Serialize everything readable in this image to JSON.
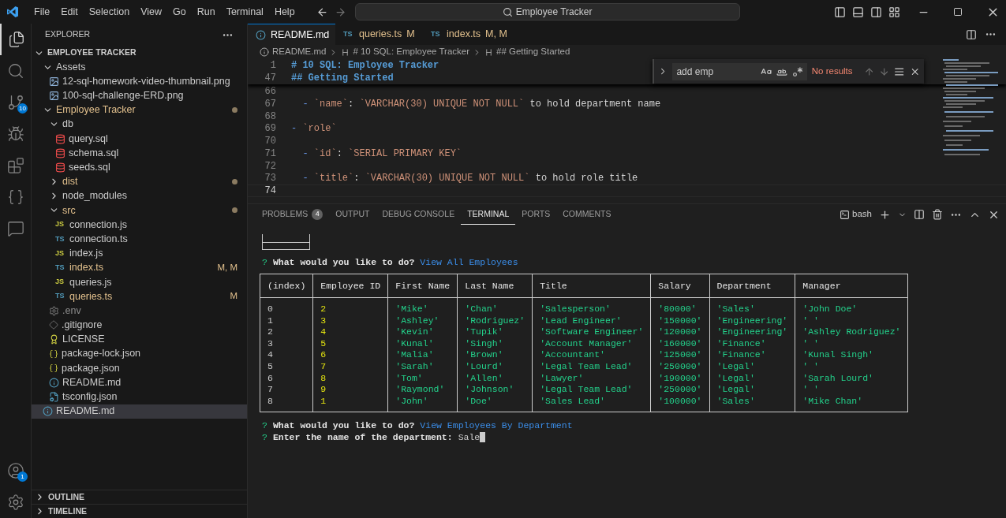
{
  "menu": [
    "File",
    "Edit",
    "Selection",
    "View",
    "Go",
    "Run",
    "Terminal",
    "Help"
  ],
  "command_center": "Employee Tracker",
  "activity_bar": [
    {
      "kind": "explorer",
      "selected": true
    },
    {
      "kind": "search",
      "selected": false
    },
    {
      "kind": "source-control",
      "selected": false,
      "badge": "10"
    },
    {
      "kind": "run",
      "selected": false
    },
    {
      "kind": "extensions",
      "selected": false
    },
    {
      "kind": "braces",
      "selected": false
    },
    {
      "kind": "chat",
      "selected": false
    }
  ],
  "activity_bottom": [
    {
      "kind": "account",
      "badge": "1"
    },
    {
      "kind": "settings"
    }
  ],
  "explorer": {
    "title": "EXPLORER",
    "root": {
      "name": "EMPLOYEE TRACKER",
      "expanded": true,
      "children": [
        {
          "name": "Assets",
          "kind": "folder",
          "expanded": true,
          "modified": false,
          "ignored": false,
          "dot": false,
          "selected": false,
          "children": [
            {
              "name": "12-sql-homework-video-thumbnail.png",
              "kind": "image",
              "modified": false,
              "ignored": false,
              "selected": false
            },
            {
              "name": "100-sql-challenge-ERD.png",
              "kind": "image",
              "modified": false,
              "ignored": false,
              "selected": false
            }
          ]
        },
        {
          "name": "Employee Tracker",
          "kind": "folder",
          "expanded": true,
          "modified": true,
          "ignored": false,
          "dot": true,
          "selected": false,
          "children": [
            {
              "name": "db",
              "kind": "folder",
              "expanded": true,
              "modified": false,
              "ignored": false,
              "dot": false,
              "selected": false,
              "children": [
                {
                  "name": "query.sql",
                  "kind": "sql",
                  "modified": false,
                  "ignored": false,
                  "selected": false
                },
                {
                  "name": "schema.sql",
                  "kind": "sql",
                  "modified": false,
                  "ignored": false,
                  "selected": false
                },
                {
                  "name": "seeds.sql",
                  "kind": "sql",
                  "modified": false,
                  "ignored": false,
                  "selected": false
                }
              ]
            },
            {
              "name": "dist",
              "kind": "folder",
              "expanded": false,
              "modified": true,
              "ignored": false,
              "dot": true,
              "selected": false
            },
            {
              "name": "node_modules",
              "kind": "folder",
              "expanded": false,
              "modified": false,
              "ignored": false,
              "dot": false,
              "selected": false
            },
            {
              "name": "src",
              "kind": "folder",
              "expanded": true,
              "modified": true,
              "ignored": false,
              "dot": true,
              "selected": false,
              "children": [
                {
                  "name": "connection.js",
                  "kind": "js",
                  "icon_label": "JS",
                  "modified": false,
                  "ignored": false,
                  "selected": false
                },
                {
                  "name": "connection.ts",
                  "kind": "ts",
                  "icon_label": "TS",
                  "modified": false,
                  "ignored": false,
                  "selected": false
                },
                {
                  "name": "index.js",
                  "kind": "js",
                  "icon_label": "JS",
                  "modified": false,
                  "ignored": false,
                  "selected": false
                },
                {
                  "name": "index.ts",
                  "kind": "ts",
                  "icon_label": "TS",
                  "modified": true,
                  "ignored": false,
                  "git": "M, M",
                  "selected": false
                },
                {
                  "name": "queries.js",
                  "kind": "js",
                  "icon_label": "JS",
                  "modified": false,
                  "ignored": false,
                  "selected": false
                },
                {
                  "name": "queries.ts",
                  "kind": "ts",
                  "icon_label": "TS",
                  "modified": true,
                  "ignored": false,
                  "git": "M",
                  "selected": false
                }
              ]
            },
            {
              "name": ".env",
              "kind": "env",
              "modified": false,
              "ignored": true,
              "selected": false
            },
            {
              "name": ".gitignore",
              "kind": "git",
              "modified": false,
              "ignored": false,
              "selected": false
            },
            {
              "name": "LICENSE",
              "kind": "license",
              "modified": false,
              "ignored": false,
              "selected": false
            },
            {
              "name": "package-lock.json",
              "kind": "json",
              "modified": false,
              "ignored": false,
              "selected": false
            },
            {
              "name": "package.json",
              "kind": "json",
              "modified": false,
              "ignored": false,
              "selected": false
            },
            {
              "name": "README.md",
              "kind": "info",
              "modified": false,
              "ignored": false,
              "selected": false
            },
            {
              "name": "tsconfig.json",
              "kind": "tsconfig",
              "modified": false,
              "ignored": false,
              "selected": false
            }
          ]
        },
        {
          "name": "README.md",
          "kind": "info",
          "modified": false,
          "ignored": false,
          "selected": true
        }
      ]
    }
  },
  "sidebar_sections": [
    {
      "title": "OUTLINE",
      "expanded": false
    },
    {
      "title": "TIMELINE",
      "expanded": false
    }
  ],
  "tabs": [
    {
      "label": "README.md",
      "kind": "info",
      "selected": true
    },
    {
      "label": "queries.ts",
      "kind": "ts",
      "icon_label": "TS",
      "badge": "M",
      "selected": false
    },
    {
      "label": "index.ts",
      "kind": "ts",
      "icon_label": "TS",
      "badge": "M, M",
      "selected": false
    }
  ],
  "breadcrumb": [
    {
      "label": "README.md",
      "kind": "info"
    },
    {
      "label": "# 10 SQL: Employee Tracker",
      "kind": "heading"
    },
    {
      "label": "## Getting Started",
      "kind": "heading"
    }
  ],
  "sticky_lines": [
    {
      "number": "1",
      "text": "# 10 SQL: Employee Tracker"
    },
    {
      "number": "47",
      "text": "## Getting Started"
    }
  ],
  "code_lines": [
    {
      "number": "66",
      "current": false
    },
    {
      "number": "67",
      "current": false,
      "segments": [
        {
          "text": "  - ",
          "kind": "punct"
        },
        {
          "text": "`name`",
          "kind": "code"
        },
        {
          "text": ": ",
          "kind": "plain"
        },
        {
          "text": "`VARCHAR(30) UNIQUE NOT NULL`",
          "kind": "code"
        },
        {
          "text": " to hold department name",
          "kind": "plain"
        }
      ]
    },
    {
      "number": "68",
      "current": false
    },
    {
      "number": "69",
      "current": false,
      "segments": [
        {
          "text": "- ",
          "kind": "punct"
        },
        {
          "text": "`role`",
          "kind": "code"
        }
      ]
    },
    {
      "number": "70",
      "current": false
    },
    {
      "number": "71",
      "current": false,
      "segments": [
        {
          "text": "  - ",
          "kind": "punct"
        },
        {
          "text": "`id`",
          "kind": "code"
        },
        {
          "text": ": ",
          "kind": "plain"
        },
        {
          "text": "`SERIAL PRIMARY KEY`",
          "kind": "code"
        }
      ]
    },
    {
      "number": "72",
      "current": false
    },
    {
      "number": "73",
      "current": false,
      "segments": [
        {
          "text": "  - ",
          "kind": "punct"
        },
        {
          "text": "`title`",
          "kind": "code"
        },
        {
          "text": ": ",
          "kind": "plain"
        },
        {
          "text": "`VARCHAR(30) UNIQUE NOT NULL`",
          "kind": "code"
        },
        {
          "text": " to hold role title",
          "kind": "plain"
        }
      ]
    },
    {
      "number": "74",
      "current": true
    }
  ],
  "find": {
    "value": "add emp",
    "result": "No results",
    "options": [
      {
        "kind": "match-case",
        "on": false
      },
      {
        "kind": "whole-word",
        "on": false
      },
      {
        "kind": "regex",
        "on": false
      }
    ]
  },
  "panel_tabs": [
    {
      "label": "PROBLEMS",
      "badge": "4",
      "selected": false
    },
    {
      "label": "OUTPUT",
      "selected": false
    },
    {
      "label": "DEBUG CONSOLE",
      "selected": false
    },
    {
      "label": "TERMINAL",
      "selected": true
    },
    {
      "label": "PORTS",
      "selected": false
    },
    {
      "label": "COMMENTS",
      "selected": false
    }
  ],
  "terminal": {
    "shell": "bash",
    "lines_before": [
      {
        "mark": "?",
        "prompt": "What would you like to do?",
        "answer": "View All Employees"
      }
    ],
    "table": {
      "columns": [
        {
          "label": "(index)",
          "kind": "index"
        },
        {
          "label": "Employee ID",
          "kind": "number"
        },
        {
          "label": "First Name",
          "kind": "string"
        },
        {
          "label": "Last Name",
          "kind": "string"
        },
        {
          "label": "Title",
          "kind": "string"
        },
        {
          "label": "Salary",
          "kind": "string"
        },
        {
          "label": "Department",
          "kind": "string"
        },
        {
          "label": "Manager",
          "kind": "string"
        }
      ],
      "rows": [
        [
          "0",
          "2",
          "'Mike'",
          "'Chan'",
          "'Salesperson'",
          "'80000'",
          "'Sales'",
          "'John Doe'"
        ],
        [
          "1",
          "3",
          "'Ashley'",
          "'Rodriguez'",
          "'Lead Engineer'",
          "'150000'",
          "'Engineering'",
          "' '"
        ],
        [
          "2",
          "4",
          "'Kevin'",
          "'Tupik'",
          "'Software Engineer'",
          "'120000'",
          "'Engineering'",
          "'Ashley Rodriguez'"
        ],
        [
          "3",
          "5",
          "'Kunal'",
          "'Singh'",
          "'Account Manager'",
          "'160000'",
          "'Finance'",
          "' '"
        ],
        [
          "4",
          "6",
          "'Malia'",
          "'Brown'",
          "'Accountant'",
          "'125000'",
          "'Finance'",
          "'Kunal Singh'"
        ],
        [
          "5",
          "7",
          "'Sarah'",
          "'Lourd'",
          "'Legal Team Lead'",
          "'250000'",
          "'Legal'",
          "' '"
        ],
        [
          "6",
          "8",
          "'Tom'",
          "'Allen'",
          "'Lawyer'",
          "'190000'",
          "'Legal'",
          "'Sarah Lourd'"
        ],
        [
          "7",
          "9",
          "'Raymond'",
          "'Johnson'",
          "'Legal Team Lead'",
          "'250000'",
          "'Legal'",
          "' '"
        ],
        [
          "8",
          "1",
          "'John'",
          "'Doe'",
          "'Sales Lead'",
          "'100000'",
          "'Sales'",
          "'Mike Chan'"
        ]
      ]
    },
    "lines_after": [
      {
        "mark": "?",
        "prompt": "What would you like to do?",
        "answer": "View Employees By Department"
      },
      {
        "mark": "?",
        "prompt": "Enter the name of the department:",
        "input": "Sale"
      }
    ]
  }
}
